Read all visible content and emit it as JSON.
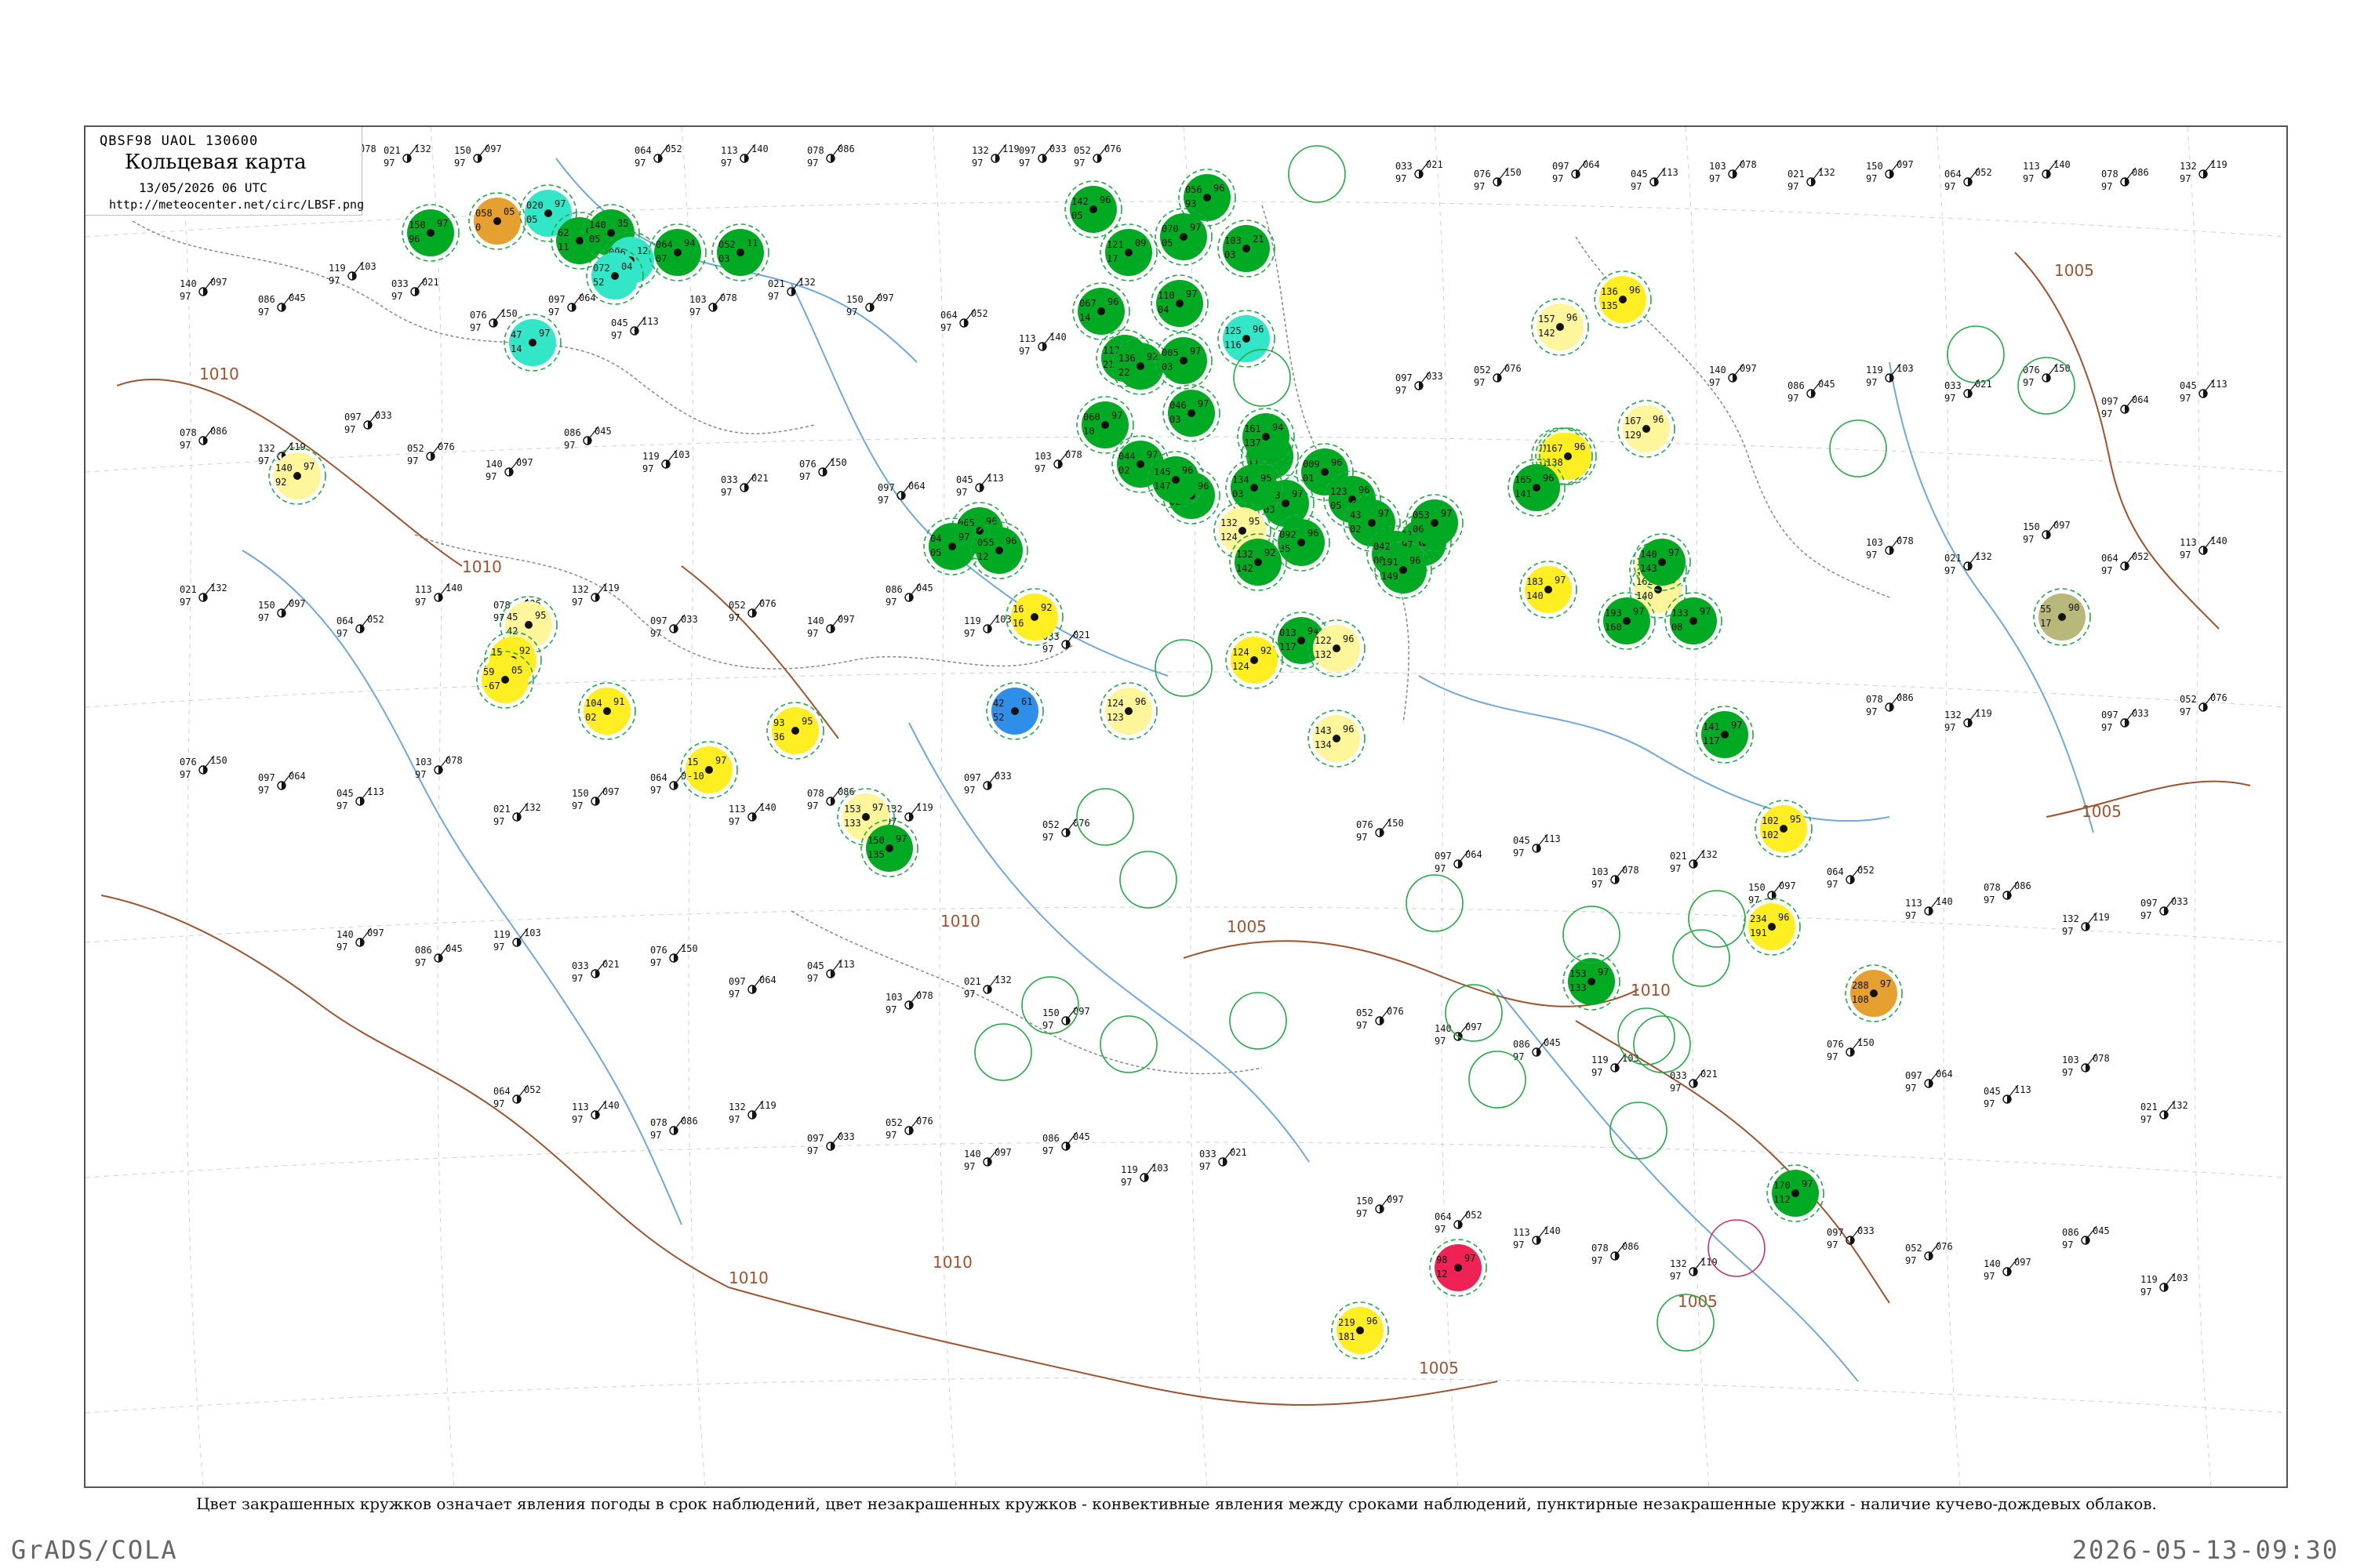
{
  "header": {
    "code": "QBSF98  UAOL  130600",
    "title": "Кольцевая карта",
    "date": "13/05/2026 06 UTC",
    "url": "http://meteocenter.net/circ/LBSF.png"
  },
  "caption": "Цвет закрашенных кружков означает явления погоды в срок наблюдений, цвет незакрашенных кружков - конвективные явления между сроками наблюдений, пунктирные незакрашенные кружки - наличие кучево-дождевых облаков.",
  "footer": {
    "left": "GrADS/COLA",
    "right": "2026-05-13-09:30"
  },
  "isobars": [
    {
      "label": "1010"
    },
    {
      "label": "1010"
    },
    {
      "label": "1010"
    },
    {
      "label": "1005"
    },
    {
      "label": "1005"
    },
    {
      "label": "1005"
    },
    {
      "label": "1005"
    },
    {
      "label": "1010"
    },
    {
      "label": "1010"
    },
    {
      "label": "1010"
    },
    {
      "label": "1005"
    }
  ],
  "colors": {
    "rain": "#00aa22",
    "drizzle": "#33e6c8",
    "fog": "#ffee22",
    "haze": "#fff59a",
    "dust": "#e6a030",
    "shower": "#2f8fe8",
    "thunder": "#ee2255",
    "mist": "#b8b87a",
    "cb_ring": "#22aa44",
    "thunder_ring": "#cc3366",
    "isobar": "#a0522d",
    "river": "#6fa8dc",
    "border": "#777777"
  },
  "stations": [
    {
      "v": [
        "150",
        "97",
        "96"
      ],
      "w": "rain"
    },
    {
      "v": [
        "058",
        "05",
        "0"
      ],
      "w": "dust"
    },
    {
      "v": [
        "020",
        "97",
        "05"
      ],
      "w": "drizzle"
    },
    {
      "v": [
        "62",
        "09",
        "11"
      ],
      "w": "rain"
    },
    {
      "v": [
        "140",
        "35",
        "05"
      ],
      "w": "rain"
    },
    {
      "v": [
        "096",
        "12",
        "04"
      ],
      "w": "drizzle"
    },
    {
      "v": [
        "072",
        "04",
        "52"
      ],
      "w": "drizzle"
    },
    {
      "v": [
        "064",
        "94",
        "07"
      ],
      "w": "rain"
    },
    {
      "v": [
        "052",
        "11",
        "03"
      ],
      "w": "rain"
    },
    {
      "v": [
        "47",
        "97",
        "14"
      ],
      "w": "drizzle"
    },
    {
      "v": [
        "142",
        "96",
        "05"
      ],
      "w": "rain"
    },
    {
      "v": [
        "056",
        "96",
        "93"
      ],
      "w": "rain"
    },
    {
      "v": [
        "070",
        "97",
        "05"
      ],
      "w": "rain"
    },
    {
      "v": [
        "103",
        "21",
        "03"
      ],
      "w": "rain"
    },
    {
      "v": [
        "121",
        "09",
        "17"
      ],
      "w": "rain"
    },
    {
      "v": [
        "110",
        "97",
        "04"
      ],
      "w": "rain"
    },
    {
      "v": [
        "067",
        "96",
        "14"
      ],
      "w": "rain"
    },
    {
      "v": [
        "117",
        "96",
        "21"
      ],
      "w": "rain"
    },
    {
      "v": [
        "136",
        "92",
        "22"
      ],
      "w": "rain"
    },
    {
      "v": [
        "005",
        "97",
        "03"
      ],
      "w": "rain"
    },
    {
      "v": [
        "125",
        "96",
        "116"
      ],
      "w": "drizzle"
    },
    {
      "v": [
        "060",
        "97",
        "10"
      ],
      "w": "rain"
    },
    {
      "v": [
        "046",
        "97",
        "03"
      ],
      "w": "rain"
    },
    {
      "v": [
        "044",
        "97",
        "02"
      ],
      "w": "rain"
    },
    {
      "v": [
        "051",
        "96",
        "02"
      ],
      "w": "rain"
    },
    {
      "v": [
        "045",
        "97",
        "11"
      ],
      "w": "rain"
    },
    {
      "v": [
        "009",
        "96",
        "01"
      ],
      "w": "rain"
    },
    {
      "v": [
        "053",
        "97",
        "03"
      ],
      "w": "rain"
    },
    {
      "v": [
        "123",
        "96",
        "05"
      ],
      "w": "rain"
    },
    {
      "v": [
        "013",
        "94",
        "117"
      ],
      "w": "rain"
    },
    {
      "v": [
        "134",
        "95",
        "03"
      ],
      "w": "rain"
    },
    {
      "v": [
        "132",
        "95",
        "124"
      ],
      "w": "haze"
    },
    {
      "v": [
        "065",
        "96",
        "02"
      ],
      "w": "rain"
    },
    {
      "v": [
        "04",
        "97",
        "05"
      ],
      "w": "rain"
    },
    {
      "v": [
        "055",
        "96",
        "12"
      ],
      "w": "rain"
    },
    {
      "v": [
        "092",
        "96",
        "35"
      ],
      "w": "rain"
    },
    {
      "v": [
        "43",
        "97",
        "02"
      ],
      "w": "rain"
    },
    {
      "v": [
        "02",
        "96",
        "01"
      ],
      "w": "rain"
    },
    {
      "v": [
        "053",
        "97",
        "06"
      ],
      "w": "rain"
    },
    {
      "v": [
        "042",
        "97",
        "08"
      ],
      "w": "rain"
    },
    {
      "v": [
        "16",
        "92",
        "16"
      ],
      "w": "fog"
    },
    {
      "v": [
        "42",
        "61",
        "52"
      ],
      "w": "shower"
    },
    {
      "v": [
        "124",
        "96",
        "123"
      ],
      "w": "haze"
    },
    {
      "v": [
        "124",
        "92",
        "124"
      ],
      "w": "fog"
    },
    {
      "v": [
        "122",
        "96",
        "132"
      ],
      "w": "haze"
    },
    {
      "v": [
        "143",
        "96",
        "134"
      ],
      "w": "haze"
    },
    {
      "v": [
        "136",
        "96",
        "135"
      ],
      "w": "fog"
    },
    {
      "v": [
        "157",
        "96",
        "142"
      ],
      "w": "haze"
    },
    {
      "v": [
        "167",
        "96",
        "129"
      ],
      "w": "haze"
    },
    {
      "v": [
        "154",
        "94",
        "136"
      ],
      "w": "haze"
    },
    {
      "v": [
        "143",
        "95",
        "135"
      ],
      "w": "fog"
    },
    {
      "v": [
        "167",
        "96",
        "138"
      ],
      "w": "fog"
    },
    {
      "v": [
        "183",
        "97",
        "140"
      ],
      "w": "fog"
    },
    {
      "v": [
        "151",
        "92",
        "140"
      ],
      "w": "haze"
    },
    {
      "v": [
        "162",
        "96",
        "140"
      ],
      "w": "haze"
    },
    {
      "v": [
        "102",
        "95",
        "102"
      ],
      "w": "fog"
    },
    {
      "v": [
        "234",
        "96",
        "191"
      ],
      "w": "fog"
    },
    {
      "v": [
        "219",
        "96",
        "181"
      ],
      "w": "fog"
    },
    {
      "v": [
        "98",
        "97",
        "12"
      ],
      "w": "thunder"
    },
    {
      "v": [
        "288",
        "97",
        "108"
      ],
      "w": "dust"
    },
    {
      "v": [
        "55",
        "90",
        "17"
      ],
      "w": "mist"
    },
    {
      "v": [
        "140",
        "97",
        "92"
      ],
      "w": "haze"
    },
    {
      "v": [
        "45",
        "95",
        "42"
      ],
      "w": "haze"
    },
    {
      "v": [
        "15",
        "92",
        "097"
      ],
      "w": "fog"
    },
    {
      "v": [
        "59",
        "05",
        "-67"
      ],
      "w": "fog"
    },
    {
      "v": [
        "104",
        "91",
        "02"
      ],
      "w": "fog"
    },
    {
      "v": [
        "93",
        "95",
        "36"
      ],
      "w": "fog"
    },
    {
      "v": [
        "15",
        "97",
        "-10"
      ],
      "w": "fog"
    },
    {
      "v": [
        "153",
        "97",
        "133"
      ],
      "w": "haze"
    },
    {
      "v": [
        "150",
        "97",
        "135"
      ],
      "w": "rain"
    },
    {
      "v": [
        "133",
        "97",
        "08"
      ],
      "w": "rain"
    },
    {
      "v": [
        "141",
        "97",
        "117"
      ],
      "w": "rain"
    },
    {
      "v": [
        "193",
        "97",
        "160"
      ],
      "w": "rain"
    },
    {
      "v": [
        "165",
        "96",
        "141"
      ],
      "w": "rain"
    },
    {
      "v": [
        "161",
        "94",
        "137"
      ],
      "w": "rain"
    },
    {
      "v": [
        "145",
        "96",
        "147"
      ],
      "w": "rain"
    },
    {
      "v": [
        "140",
        "97",
        "143"
      ],
      "w": "rain"
    },
    {
      "v": [
        "132",
        "92",
        "142"
      ],
      "w": "rain"
    },
    {
      "v": [
        "191",
        "96",
        "149"
      ],
      "w": "rain"
    },
    {
      "v": [
        "153",
        "97",
        "133"
      ],
      "w": "rain"
    },
    {
      "v": [
        "170",
        "97",
        "112"
      ],
      "w": "rain"
    }
  ]
}
